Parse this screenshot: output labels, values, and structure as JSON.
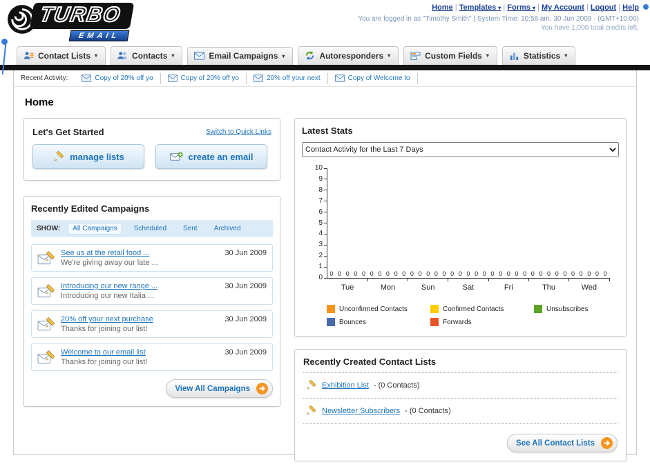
{
  "header": {
    "logo": {
      "brand": "TURBO",
      "sub": "EMAIL"
    },
    "nav_links": [
      {
        "label": "Home",
        "dropdown": false
      },
      {
        "label": "Templates",
        "dropdown": true
      },
      {
        "label": "Forms",
        "dropdown": true
      },
      {
        "label": "My Account",
        "dropdown": false
      },
      {
        "label": "Logout",
        "dropdown": false
      },
      {
        "label": "Help",
        "dropdown": false
      }
    ],
    "login_info": "You are logged in as \"Timothy Smith\" | System Time: 10:58 am, 30 Jun 2009 - (GMT+10:00)",
    "credits_info": "You have 1,000 total credits left."
  },
  "main_nav": [
    {
      "label": "Contact Lists",
      "icon": "contact-lists-icon"
    },
    {
      "label": "Contacts",
      "icon": "contacts-icon"
    },
    {
      "label": "Email Campaigns",
      "icon": "email-campaigns-icon"
    },
    {
      "label": "Autoresponders",
      "icon": "autoresponders-icon"
    },
    {
      "label": "Custom Fields",
      "icon": "custom-fields-icon"
    },
    {
      "label": "Statistics",
      "icon": "statistics-icon"
    }
  ],
  "recent_activity": {
    "label": "Recent Activity:",
    "items": [
      "Copy of 20% off yo",
      "Copy of 20% off yo",
      "20% off your next",
      "Copy of Welcome to"
    ]
  },
  "page_title": "Home",
  "get_started": {
    "title": "Let's Get Started",
    "switch_link": "Switch to Quick Links",
    "buttons": [
      {
        "label": "manage lists",
        "icon": "pencil-icon"
      },
      {
        "label": "create an email",
        "icon": "new-email-icon"
      }
    ]
  },
  "campaigns": {
    "title": "Recently Edited Campaigns",
    "show_label": "SHOW:",
    "filters": [
      {
        "label": "All Campaigns",
        "selected": true
      },
      {
        "label": "Scheduled",
        "selected": false
      },
      {
        "label": "Sent",
        "selected": false
      },
      {
        "label": "Archived",
        "selected": false
      }
    ],
    "items": [
      {
        "title": "See us at the retail food ...",
        "subtitle": "We're giving away our late ...",
        "date": "30 Jun 2009"
      },
      {
        "title": "Introducing our new range ...",
        "subtitle": "Introducing our new Italia ...",
        "date": "30 Jun 2009"
      },
      {
        "title": "20% off your next purchase",
        "subtitle": "Thanks for joining our list!",
        "date": "30 Jun 2009"
      },
      {
        "title": "Welcome to our email list",
        "subtitle": "Thanks for joining our list!",
        "date": "30 Jun 2009"
      }
    ],
    "view_all_label": "View All Campaigns"
  },
  "stats": {
    "title": "Latest Stats",
    "selected_option": "Contact Activity for the Last 7 Days"
  },
  "chart_data": {
    "type": "bar",
    "title": "Contact Activity for the Last 7 Days",
    "categories": [
      "Tue",
      "Mon",
      "Sun",
      "Sat",
      "Fri",
      "Thu",
      "Wed"
    ],
    "series": [
      {
        "name": "Unconfirmed Contacts",
        "color": "#f7941d",
        "values": [
          0,
          0,
          0,
          0,
          0,
          0,
          0
        ]
      },
      {
        "name": "Confirmed Contacts",
        "color": "#ffcc00",
        "values": [
          0,
          0,
          0,
          0,
          0,
          0,
          0
        ]
      },
      {
        "name": "Unsubscribes",
        "color": "#5ca424",
        "values": [
          0,
          0,
          0,
          0,
          0,
          0,
          0
        ]
      },
      {
        "name": "Bounces",
        "color": "#4a69a8",
        "values": [
          0,
          0,
          0,
          0,
          0,
          0,
          0
        ]
      },
      {
        "name": "Forwards",
        "color": "#e8542a",
        "values": [
          0,
          0,
          0,
          0,
          0,
          0,
          0
        ]
      }
    ],
    "ylim": [
      0,
      10
    ],
    "yticks": [
      0,
      1,
      2,
      3,
      4,
      5,
      6,
      7,
      8,
      9,
      10
    ],
    "xlabel": "",
    "ylabel": "",
    "grid": false,
    "legend_position": "bottom"
  },
  "contact_lists": {
    "title": "Recently Created Contact Lists",
    "items": [
      {
        "name": "Exhibition List",
        "detail": "- (0 Contacts)"
      },
      {
        "name": "Newsletter Subscribers",
        "detail": "- (0 Contacts)"
      }
    ],
    "see_all_label": "See All Contact Lists"
  }
}
